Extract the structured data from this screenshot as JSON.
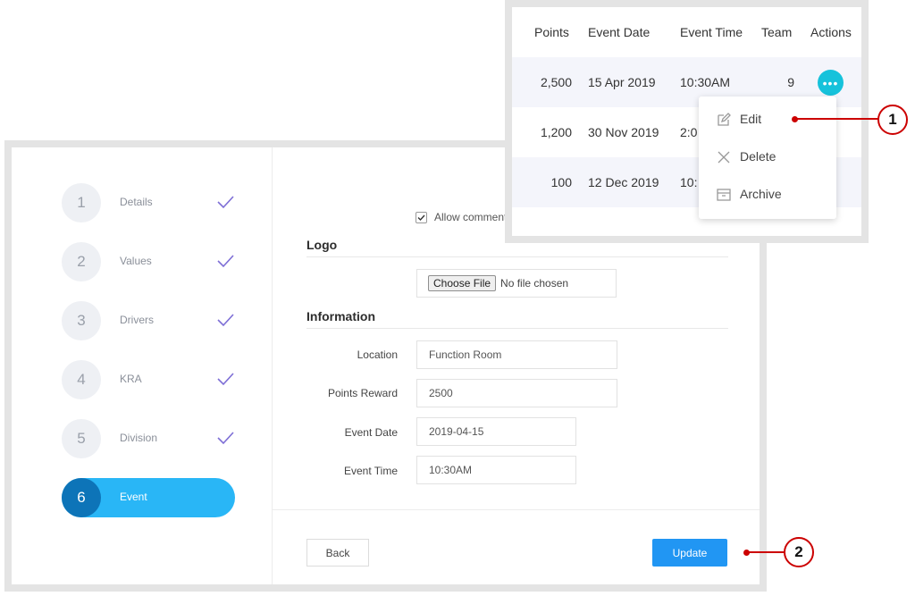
{
  "steps": [
    {
      "num": "1",
      "label": "Details",
      "done": true
    },
    {
      "num": "2",
      "label": "Values",
      "done": true
    },
    {
      "num": "3",
      "label": "Drivers",
      "done": true
    },
    {
      "num": "4",
      "label": "KRA",
      "done": true
    },
    {
      "num": "5",
      "label": "Division",
      "done": true
    },
    {
      "num": "6",
      "label": "Event",
      "done": false,
      "active": true
    }
  ],
  "form": {
    "allow_comment_label": "Allow comment",
    "allow_comment_checked": true,
    "logo_section": "Logo",
    "choose_file_label": "Choose File",
    "no_file_text": "No file chosen",
    "information_section": "Information",
    "location_label": "Location",
    "location_value": "Function Room",
    "points_label": "Points Reward",
    "points_value": "2500",
    "date_label": "Event Date",
    "date_value": "2019-04-15",
    "time_label": "Event Time",
    "time_value": "10:30AM",
    "back_label": "Back",
    "update_label": "Update"
  },
  "table": {
    "headers": {
      "points": "Points",
      "date": "Event Date",
      "time": "Event Time",
      "team": "Team",
      "actions": "Actions"
    },
    "rows": [
      {
        "points": "2,500",
        "date": "15 Apr 2019",
        "time": "10:30AM",
        "team": "9"
      },
      {
        "points": "1,200",
        "date": "30 Nov 2019",
        "time": "2:0"
      },
      {
        "points": "100",
        "date": "12 Dec 2019",
        "time": "10:"
      }
    ],
    "actions_icon": "more-horizontal-icon"
  },
  "menu": {
    "items": [
      {
        "label": "Edit",
        "icon": "edit-icon"
      },
      {
        "label": "Delete",
        "icon": "close-icon"
      },
      {
        "label": "Archive",
        "icon": "archive-icon"
      }
    ]
  },
  "callouts": {
    "one": "1",
    "two": "2"
  },
  "colors": {
    "accent": "#29b6f6",
    "active_step_num": "#0d74b8",
    "update_button": "#2196f3",
    "action_button": "#16c2db",
    "check": "#7e6fd6",
    "callout": "#cc0000"
  }
}
